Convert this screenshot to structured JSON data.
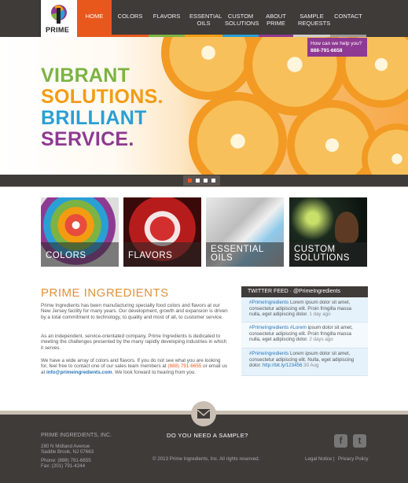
{
  "brand": {
    "logo_text": "PRIME"
  },
  "nav": [
    {
      "label": "HOME",
      "active": true
    },
    {
      "label": "COLORS"
    },
    {
      "label": "FLAVORS"
    },
    {
      "label": "ESSENTIAL OILS"
    },
    {
      "label": "CUSTOM SOLUTIONS"
    },
    {
      "label": "ABOUT PRIME"
    },
    {
      "label": "SAMPLE REQUESTS"
    },
    {
      "label": "CONTACT"
    }
  ],
  "nav_colors": [
    "#e8581d",
    "#e8581d",
    "#7cb342",
    "#f39c12",
    "#2a9fd6",
    "#8e3a92",
    "#cccccc",
    "#999999"
  ],
  "hero": {
    "line1": "VIBRANT",
    "line2": "SOLUTIONS.",
    "line3": "BRILLIANT",
    "line4": "SERVICE.",
    "colors": [
      "#7cb342",
      "#f39c12",
      "#2a9fd6",
      "#8e3a92"
    ]
  },
  "help": {
    "question": "How can we help you?",
    "phone": "888-791-6658"
  },
  "tiles": [
    {
      "label": "COLORS"
    },
    {
      "label": "FLAVORS"
    },
    {
      "label": "ESSENTIAL OILS"
    },
    {
      "label": "CUSTOM SOLUTIONS"
    }
  ],
  "about": {
    "title": "PRIME INGREDIENTS",
    "p1": "Prime Ingredients has been manufacturing specialty food colors and flavors at our New Jersey facility for many years. Our development, growth and expansion is driven by a total commitment to technology, to quality and most of all, to customer service.",
    "p2": "As an independent, service-orientated company, Prime Ingredients is dedicated to meeting the challenges presented by the many rapidly developing industries in which it serves.",
    "p3_a": "We have a wide array of colors and flavors. If you do not see what you are looking for, feel free to contact one of our sales team members at",
    "p3_phone": "(888) 791-6655",
    "p3_b": "or email us at",
    "p3_email": "info@primeingredients.com",
    "p3_c": ". We look forward to hearing from you."
  },
  "twitter": {
    "header": "TWITTER FEED  ·  @PrimeIngredients",
    "tweets": [
      {
        "tag": "#PrimeIngredients",
        "text": " Lorem ipsum dolor sit amet, consectetur adipiscing elit. Proin fringilla massa nulla, eget adipiscing dolor.",
        "time": " 1 day ago"
      },
      {
        "tag": "#PrimeIngredients #Lorem",
        "text": " ipsum dolor sit amet, consectetur adipiscing elit. Proin fringilla massa nulla, eget adipiscing dolor.",
        "time": " 2 days ago"
      },
      {
        "tag": "#PrimeIngredients",
        "text": " Lorem ipsum dolor sit amet, consectetur adipiscing elit. Nulla, eget adipiscing dolor.",
        "link": " http://bit.ly/123456",
        "time": " 30 Aug"
      }
    ]
  },
  "footer": {
    "company": "PRIME INGREDIENTS, INC.",
    "addr1": "280 N Midland Avenue",
    "addr2": "Saddle Brook, NJ 07663",
    "phone": "Phone: (888) 791-6655",
    "fax": "Fax: (201) 791-4244",
    "sample_cta": "DO YOU NEED A SAMPLE?",
    "copyright": "© 2013 Prime Ingredients, Inc. All rights reserved.",
    "legal": "Legal Notice",
    "privacy": "Privacy Policy",
    "sep": "|",
    "fb": "f",
    "tw_icon": "t"
  }
}
